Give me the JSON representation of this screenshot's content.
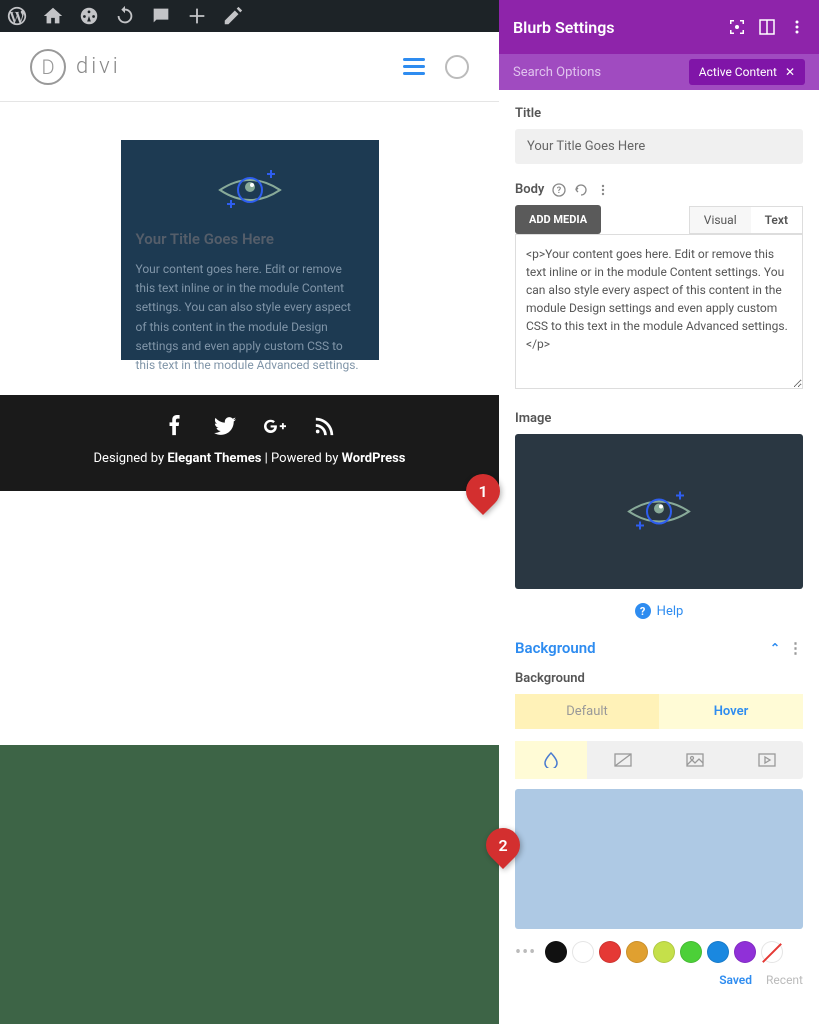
{
  "adminbar": {
    "badge": "*"
  },
  "site": {
    "logo_letter": "D",
    "logo_text": "divi"
  },
  "preview": {
    "title": "Your Title Goes Here",
    "body": "Your content goes here. Edit or remove this text inline or in the module Content settings. You can also style every aspect of this content in the module Design settings and even apply custom CSS to this text in the module Advanced settings."
  },
  "footer": {
    "designed_by": "Designed by ",
    "theme": "Elegant Themes",
    "sep": " | ",
    "powered_by": "Powered by ",
    "platform": "WordPress"
  },
  "panel": {
    "title": "Blurb Settings",
    "search_placeholder": "Search Options",
    "active_tag": "Active Content",
    "title_label": "Title",
    "title_value": "Your Title Goes Here",
    "body_label": "Body",
    "add_media": "ADD MEDIA",
    "visual_tab": "Visual",
    "text_tab": "Text",
    "body_text": "<p>Your content goes here. Edit or remove this text inline or in the module Content settings. You can also style every aspect of this content in the module Design settings and even apply custom CSS to this text in the module Advanced settings.</p>",
    "image_label": "Image",
    "help": "Help",
    "background_section": "Background",
    "background_label": "Background",
    "default_tab": "Default",
    "hover_tab": "Hover",
    "color_preview": "#aec9e4",
    "swatches": [
      "#111111",
      "#ffffff",
      "#e53935",
      "#e0a030",
      "#c5e04a",
      "#4cd038",
      "#1a88e0",
      "#9030d8"
    ],
    "saved_tab": "Saved",
    "recent_tab": "Recent"
  },
  "callouts": {
    "one": "1",
    "two": "2"
  }
}
